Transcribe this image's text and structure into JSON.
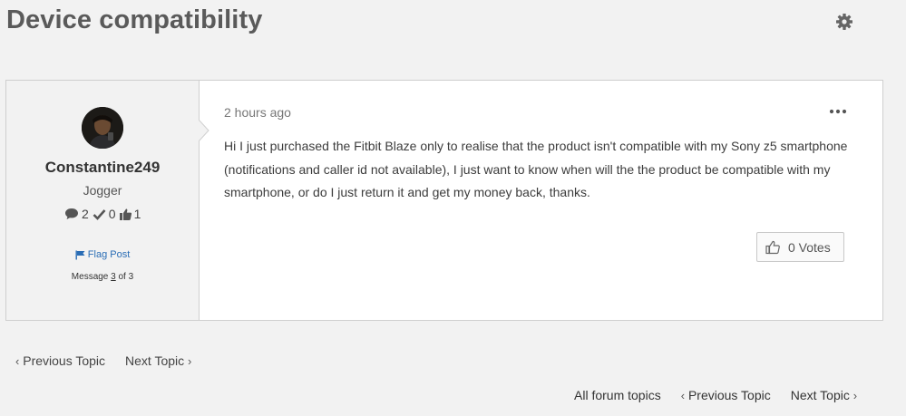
{
  "page": {
    "title": "Device compatibility"
  },
  "author": {
    "name": "Constantine249",
    "rank": "Jogger",
    "stats": {
      "replies": "2",
      "solutions": "0",
      "kudos": "1"
    },
    "flag_label": "Flag Post",
    "message_prefix": "Message ",
    "message_index": "3",
    "message_suffix": " of 3"
  },
  "post": {
    "time": "2 hours ago",
    "body": "Hi I just purchased the Fitbit Blaze only to realise that the product isn't compatible with my Sony z5 smartphone (notifications and caller id not available), I just want to know when will the the product be compatible with my smartphone, or do I just return it and get my money back, thanks.",
    "votes_label": "0 Votes"
  },
  "nav": {
    "previous_topic": "Previous Topic",
    "next_topic": "Next Topic",
    "all_topics": "All forum topics"
  },
  "icons": {
    "settings": "gear-icon",
    "more": "ellipsis-icon",
    "thumbs_up": "thumbs-up-icon",
    "flag": "flag-icon",
    "speech": "speech-bubble-icon",
    "check": "checkmark-icon"
  },
  "colors": {
    "link": "#2a6db5",
    "background": "#f2f2f2"
  }
}
